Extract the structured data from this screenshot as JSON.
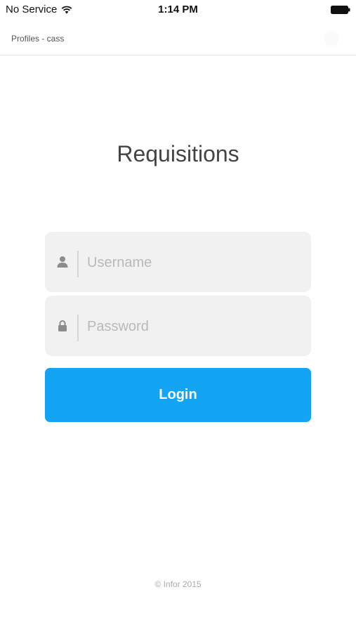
{
  "status_bar": {
    "carrier": "No Service",
    "time": "1:14 PM",
    "wifi_icon": "wifi-icon",
    "battery_icon": "battery-icon"
  },
  "nav": {
    "profiles_label": "Profiles - cass"
  },
  "app": {
    "title": "Requisitions"
  },
  "login_form": {
    "username": {
      "icon": "user-icon",
      "placeholder": "Username",
      "value": ""
    },
    "password": {
      "icon": "lock-icon",
      "placeholder": "Password",
      "value": ""
    },
    "login_label": "Login"
  },
  "footer": {
    "copyright": "© Infor 2015"
  },
  "colors": {
    "accent": "#13a5f4",
    "field_background": "#f1f1f1",
    "title_text": "#444444",
    "placeholder_text": "#b9b9b9"
  }
}
